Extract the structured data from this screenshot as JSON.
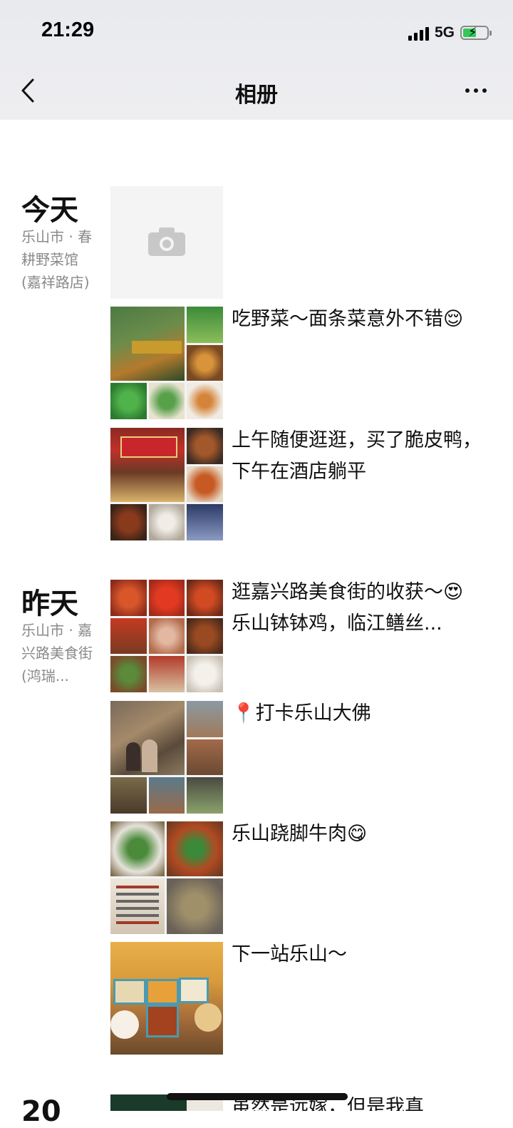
{
  "status_bar": {
    "time": "21:29",
    "network": "5G"
  },
  "nav": {
    "title": "相册"
  },
  "sections": [
    {
      "day": "今天",
      "place": "乐山市 · 春耕野菜馆 (嘉祥路店)",
      "posts": [
        {
          "type": "camera-placeholder"
        },
        {
          "text": "吃野菜～面条菜意外不错😌"
        },
        {
          "text": "上午随便逛逛，买了脆皮鸭，下午在酒店躺平"
        }
      ]
    },
    {
      "day": "昨天",
      "place": "乐山市 · 嘉兴路美食街 (鸿瑞...",
      "posts": [
        {
          "text": "逛嘉兴路美食街的收获～😍\n乐山钵钵鸡，临江鳝丝..."
        },
        {
          "text": "📍打卡乐山大佛"
        },
        {
          "text": "乐山跷脚牛肉😋"
        },
        {
          "text": "下一站乐山～"
        }
      ]
    },
    {
      "day": "20",
      "posts": [
        {
          "text": "虽然是远嫁，但是我真"
        }
      ]
    }
  ],
  "colors": {
    "accent": "#35c759",
    "secondary_text": "#8a8a8a",
    "header_bg": "#eeeef1"
  }
}
